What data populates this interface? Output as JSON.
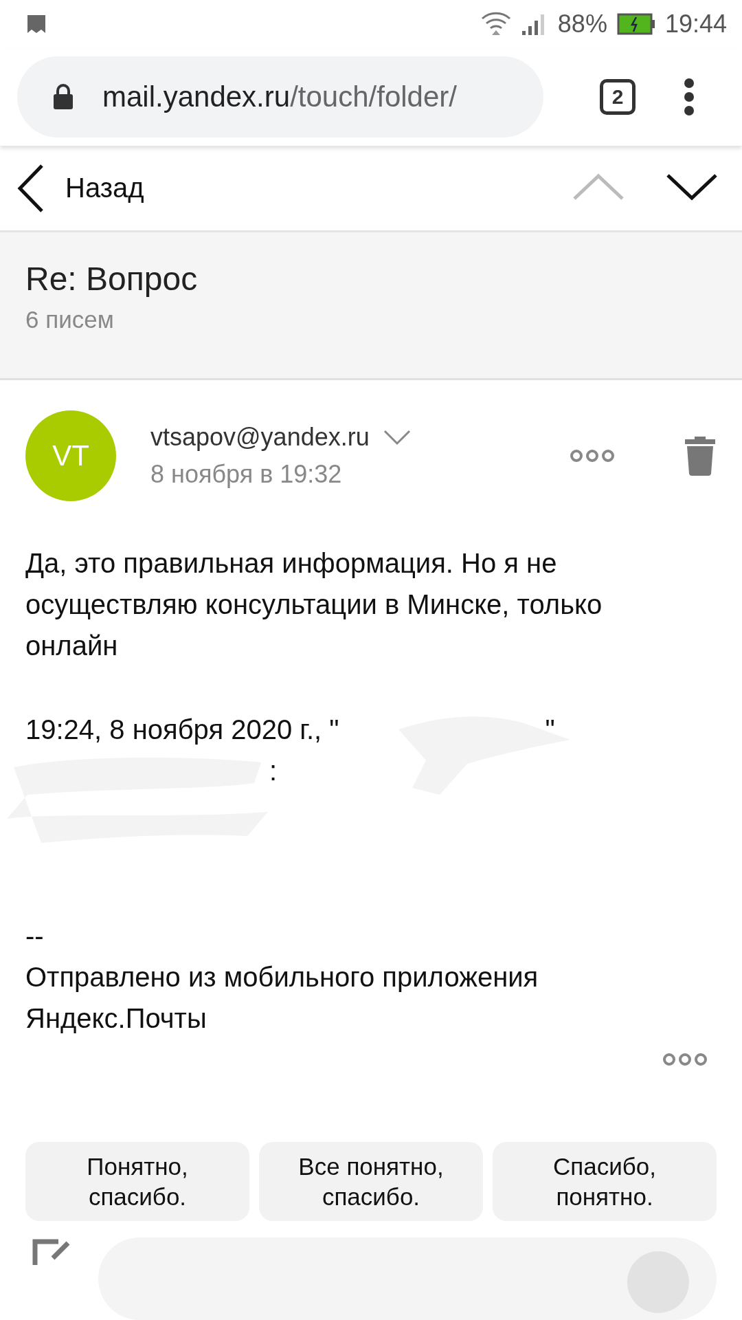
{
  "status_bar": {
    "battery": "88%",
    "time": "19:44"
  },
  "browser": {
    "url_host": "mail.yandex.ru",
    "url_path": "/touch/folder/",
    "tab_count": "2"
  },
  "nav": {
    "back": "Назад",
    "prev_disabled": true,
    "next_disabled": false
  },
  "thread": {
    "subject": "Re: Вопрос",
    "count": "6 писем"
  },
  "message": {
    "avatar": "VT",
    "sender": "vtsapov@yandex.ru",
    "date": "8 ноября в 19:32",
    "body": "Да, это правильная информация. Но я не осуществляю консультации в Минске, только онлайн",
    "quote_header": "19:24, 8 ноября 2020 г., \"",
    "quote_close": "\"",
    "quote_colon": ":",
    "separator": "--",
    "signature": "Отправлено из мобильного приложения Яндекс.Почты"
  },
  "quick_replies": [
    "Понятно, спасибо.",
    "Все понятно, спасибо.",
    "Спасибо, понятно."
  ]
}
